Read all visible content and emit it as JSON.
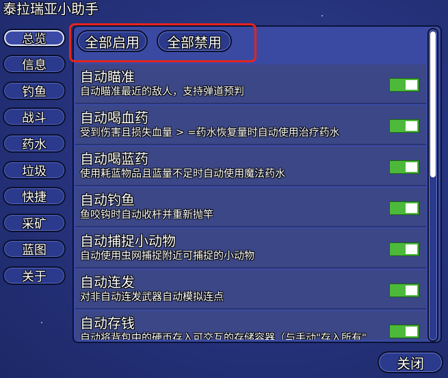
{
  "window": {
    "title": "泰拉瑞亚小助手"
  },
  "sidebar": {
    "items": [
      {
        "label": "总览",
        "active": true
      },
      {
        "label": "信息"
      },
      {
        "label": "钓鱼"
      },
      {
        "label": "战斗"
      },
      {
        "label": "药水"
      },
      {
        "label": "垃圾"
      },
      {
        "label": "快捷"
      },
      {
        "label": "采矿"
      },
      {
        "label": "蓝图"
      },
      {
        "label": "关于"
      }
    ]
  },
  "toolbar": {
    "enable_all_label": "全部启用",
    "disable_all_label": "全部禁用"
  },
  "features": [
    {
      "title": "自动瞄准",
      "desc": "自动瞄准最近的敌人，支持弹道预判",
      "enabled": true
    },
    {
      "title": "自动喝血药",
      "desc": "受到伤害且损失血量 > =药水恢复量时自动使用治疗药水",
      "enabled": true
    },
    {
      "title": "自动喝蓝药",
      "desc": "使用耗蓝物品且蓝量不足时自动使用魔法药水",
      "enabled": true
    },
    {
      "title": "自动钓鱼",
      "desc": "鱼咬钩时自动收杆并重新抛竿",
      "enabled": true
    },
    {
      "title": "自动捕捉小动物",
      "desc": "自动使用虫网捕捉附近可捕捉的小动物",
      "enabled": true
    },
    {
      "title": "自动连发",
      "desc": "对非自动连发武器自动模拟连点",
      "enabled": true
    },
    {
      "title": "自动存钱",
      "desc": "自动将背包中的硬币存入可交互的存储容器（与手动\"存入所有\"",
      "enabled": true
    }
  ],
  "footer": {
    "close_label": "关闭"
  },
  "colors": {
    "background": "#25327a",
    "toggle_on": "#4cb93a",
    "highlight": "#e8231c",
    "row_bg": "#3b4787"
  },
  "icons": {
    "toggle": "toggle-switch-icon"
  }
}
